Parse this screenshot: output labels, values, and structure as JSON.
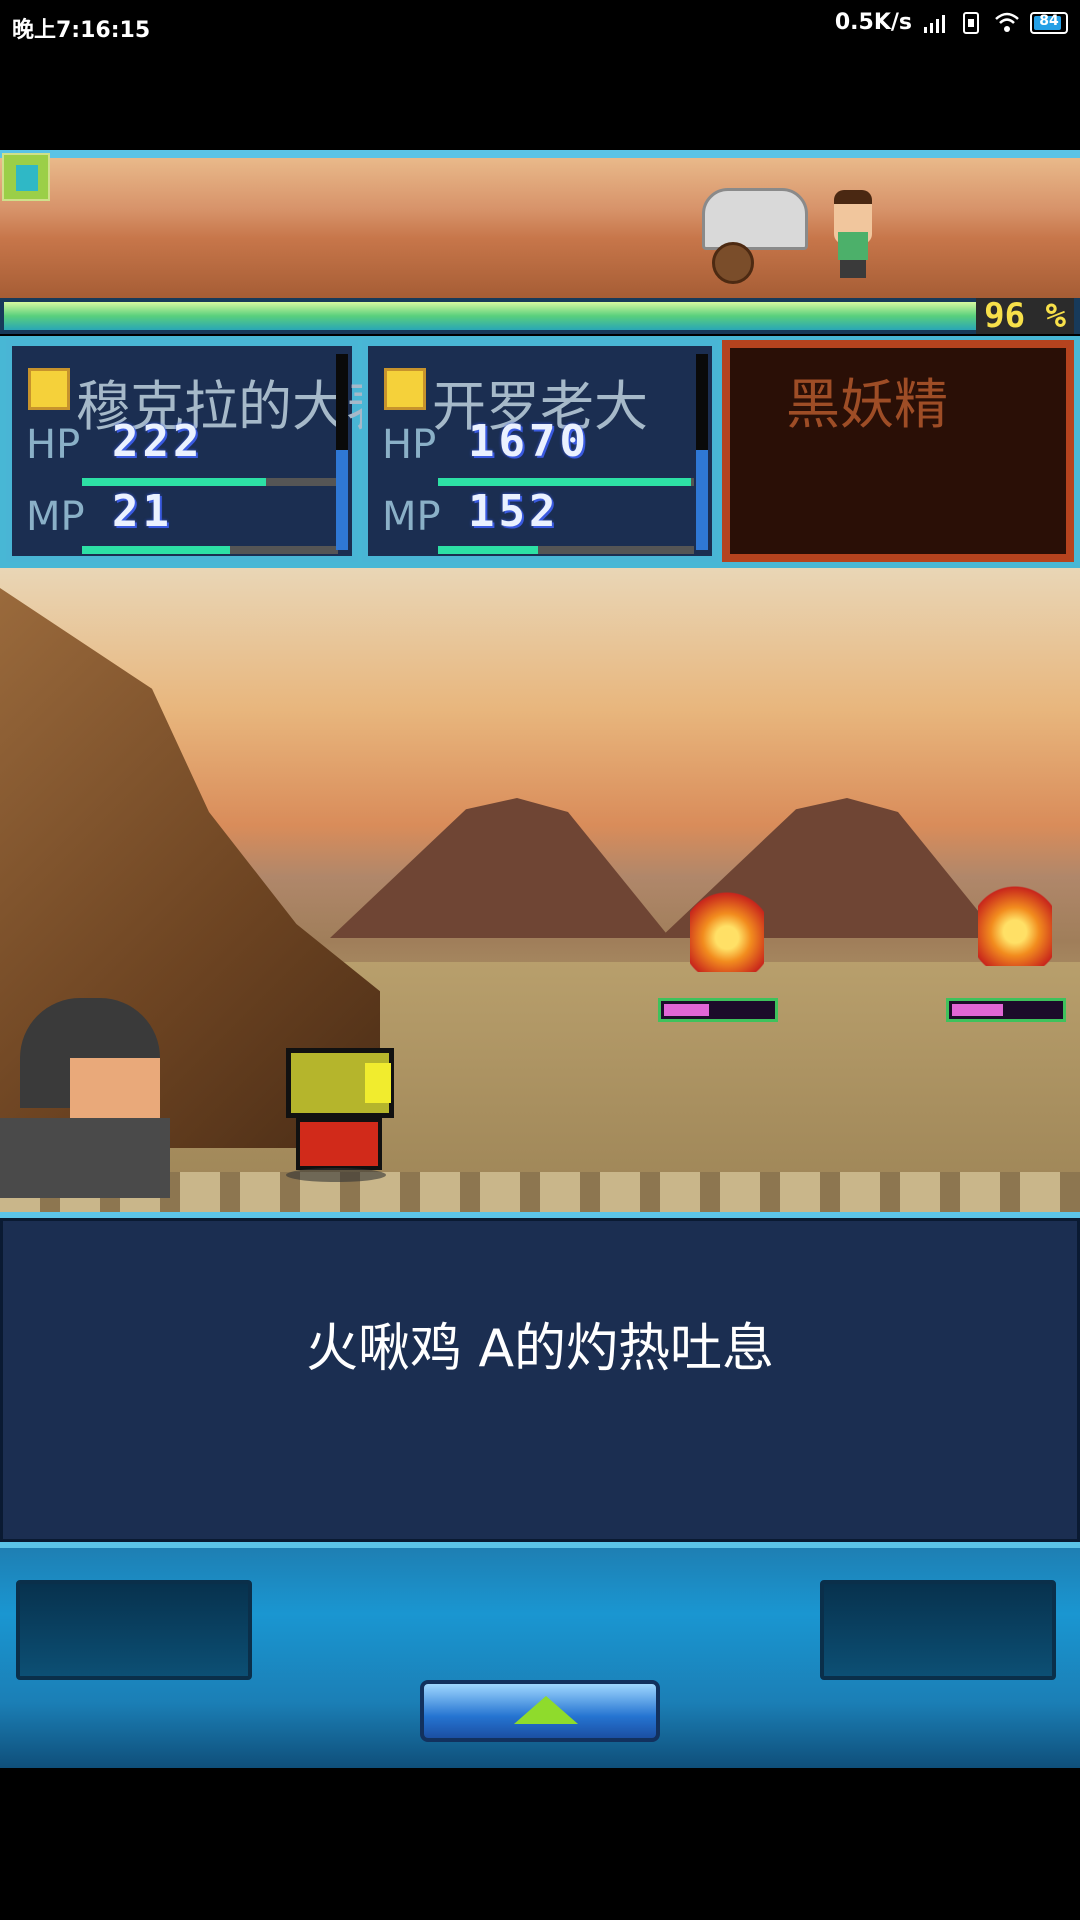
{
  "status_bar": {
    "time": "晚上7:16:15",
    "network_speed": "0.5K/s",
    "battery_level": "84"
  },
  "top_scene": {
    "progress_percent": "96 %",
    "progress_value": 0.96
  },
  "party": [
    {
      "name": "穆克拉的大表哥",
      "hp_label": "HP",
      "hp": "222",
      "hp_fill": 0.72,
      "mp_label": "MP",
      "mp": "21",
      "mp_fill": 0.58
    },
    {
      "name": "开罗老大",
      "hp_label": "HP",
      "hp": "1670",
      "hp_fill": 0.99,
      "mp_label": "MP",
      "mp": "152",
      "mp_fill": 0.39
    }
  ],
  "enemy_panel": {
    "name": "黑妖精"
  },
  "battle": {
    "enemies": [
      {
        "name": "enemy-a",
        "hp_fill": 0.45
      },
      {
        "name": "enemy-b",
        "hp_fill": 0.5
      }
    ],
    "message": "火啾鸡 A的灼热吐息"
  },
  "colors": {
    "panel_bg": "#1b2e51",
    "panel_border": "#49b5d5",
    "enemy_panel_border": "#b5431e",
    "hp_bar": "#2de0a5",
    "enemy_hp_bar": "#e066d6"
  }
}
